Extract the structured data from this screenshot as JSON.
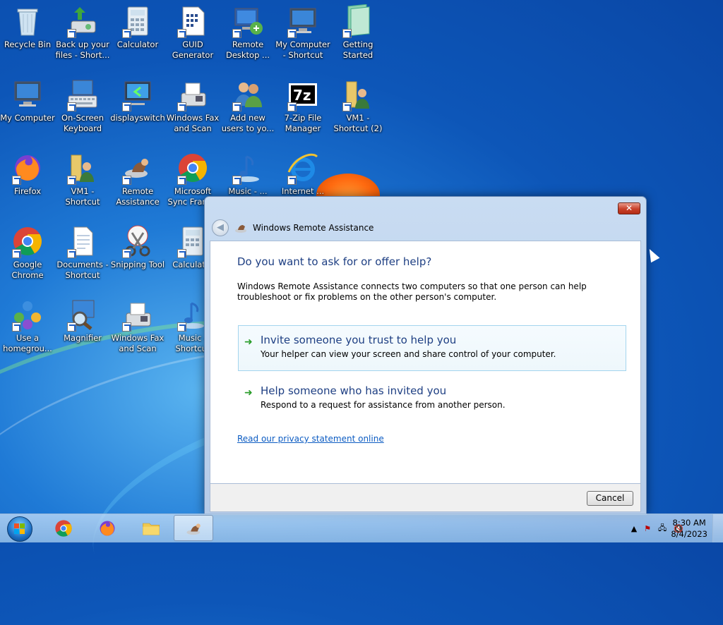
{
  "desktop": {
    "icons": [
      {
        "label": "Recycle Bin",
        "icon": "recycle-bin-icon"
      },
      {
        "label": "Back up your files - Short...",
        "icon": "backup-icon"
      },
      {
        "label": "Calculator",
        "icon": "calculator-icon"
      },
      {
        "label": "GUID Generator",
        "icon": "document-icon"
      },
      {
        "label": "Remote Desktop ...",
        "icon": "remote-desktop-icon"
      },
      {
        "label": "My Computer - Shortcut",
        "icon": "computer-icon"
      },
      {
        "label": "Getting Started",
        "icon": "getting-started-icon"
      },
      {
        "label": "My Computer",
        "icon": "computer-icon"
      },
      {
        "label": "On-Screen Keyboard",
        "icon": "keyboard-icon"
      },
      {
        "label": "displayswitch",
        "icon": "display-icon"
      },
      {
        "label": "Windows Fax and Scan",
        "icon": "fax-icon"
      },
      {
        "label": "Add new users to yo...",
        "icon": "users-icon"
      },
      {
        "label": "7-Zip File Manager",
        "icon": "7zip-icon"
      },
      {
        "label": "VM1 - Shortcut (2)",
        "icon": "folder-user-icon"
      },
      {
        "label": "Firefox",
        "icon": "firefox-icon"
      },
      {
        "label": "VM1 - Shortcut",
        "icon": "folder-user-icon"
      },
      {
        "label": "Remote Assistance",
        "icon": "remote-assistance-icon"
      },
      {
        "label": "Microsoft Sync Fram...",
        "icon": "chrome-icon"
      },
      {
        "label": "Music - ...",
        "icon": "music-icon"
      },
      {
        "label": "Internet ...",
        "icon": "ie-icon"
      },
      {
        "label": "Google Chrome",
        "icon": "chrome-icon"
      },
      {
        "label": "Documents - Shortcut",
        "icon": "documents-icon"
      },
      {
        "label": "Snipping Tool",
        "icon": "scissors-icon"
      },
      {
        "label": "Calculat...",
        "icon": "calculator-icon"
      },
      {
        "label": "Use a homegrou...",
        "icon": "homegroup-icon"
      },
      {
        "label": "Magnifier",
        "icon": "magnifier-icon"
      },
      {
        "label": "Windows Fax and Scan",
        "icon": "fax-icon"
      },
      {
        "label": "Music - Shortcut",
        "icon": "music-icon"
      }
    ]
  },
  "dialog": {
    "title": "Windows Remote Assistance",
    "close_label": "✕",
    "heading": "Do you want to ask for or offer help?",
    "description": "Windows Remote Assistance connects two computers so that one person can help troubleshoot or fix problems on the other person's computer.",
    "option_invite": {
      "title": "Invite someone you trust to help you",
      "subtitle": "Your helper can view your screen and share control of your computer."
    },
    "option_help": {
      "title": "Help someone who has invited you",
      "subtitle": "Respond to a request for assistance from another person."
    },
    "privacy_link": "Read our privacy statement online",
    "cancel_label": "Cancel"
  },
  "taskbar": {
    "apps": [
      "chrome-icon",
      "firefox-icon",
      "file-explorer-icon",
      "remote-assistance-icon"
    ],
    "clock_time": "8:30 AM",
    "clock_date": "8/4/2023",
    "tray_icons": [
      "show-hidden-icons-icon",
      "action-center-icon",
      "network-icon",
      "volume-muted-icon"
    ]
  }
}
